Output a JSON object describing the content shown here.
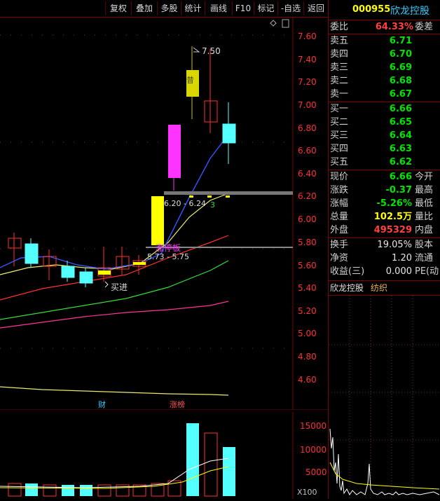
{
  "toolbar": {
    "buttons": [
      "复权",
      "叠加",
      "多股",
      "统计",
      "画线",
      "F10",
      "标记",
      "-自选",
      "返回"
    ]
  },
  "chart": {
    "price_ticks": [
      "7.60",
      "7.40",
      "7.20",
      "7.00",
      "6.80",
      "6.60",
      "6.40",
      "6.20",
      "6.00",
      "5.80",
      "5.60",
      "5.40",
      "5.20",
      "5.00",
      "4.80",
      "4.60"
    ],
    "vol_ticks": [
      "15000",
      "10000",
      "5000"
    ],
    "vol_unit": "X100",
    "high_label": "7.50",
    "gap_label_1": "6.20 - 6.24",
    "gap_label_2": "5.73 - 5.75",
    "gap_count": "3",
    "limit_up_label": "涨停板",
    "buy_label": "买进",
    "candle_mark": "昔",
    "event_fin": "财",
    "event_limit": "涨榜"
  },
  "stock": {
    "code": "000955",
    "name": "欣龙控股",
    "industry": "纺织",
    "weibi_label": "委比",
    "weibi_value": "64.33%",
    "weicha_label": "委差",
    "sell": [
      {
        "label": "卖五",
        "price": "6.71"
      },
      {
        "label": "卖四",
        "price": "6.70"
      },
      {
        "label": "卖三",
        "price": "6.69"
      },
      {
        "label": "卖二",
        "price": "6.68"
      },
      {
        "label": "卖一",
        "price": "6.67"
      }
    ],
    "buy": [
      {
        "label": "买一",
        "price": "6.66"
      },
      {
        "label": "买二",
        "price": "6.65"
      },
      {
        "label": "买三",
        "price": "6.64"
      },
      {
        "label": "买四",
        "price": "6.63"
      },
      {
        "label": "买五",
        "price": "6.62"
      }
    ],
    "quote": [
      {
        "label": "现价",
        "value": "6.66",
        "right": "今开",
        "color": "green"
      },
      {
        "label": "涨跌",
        "value": "-0.37",
        "right": "最高",
        "color": "green"
      },
      {
        "label": "涨幅",
        "value": "-5.26%",
        "right": "最低",
        "color": "green"
      },
      {
        "label": "总量",
        "value": "102.5万",
        "right": "量比",
        "color": "yellow"
      },
      {
        "label": "外盘",
        "value": "495329",
        "right": "内盘",
        "color": "red"
      }
    ],
    "stats": [
      {
        "label": "换手",
        "value": "19.05%",
        "right": "股本"
      },
      {
        "label": "净资",
        "value": "1.20",
        "right": "流通"
      },
      {
        "label": "收益(三)",
        "value": "0.000",
        "right": "PE(动"
      }
    ]
  },
  "colors": {
    "up": "#ff3030",
    "down": "#54ffff",
    "frame": "#800000"
  }
}
